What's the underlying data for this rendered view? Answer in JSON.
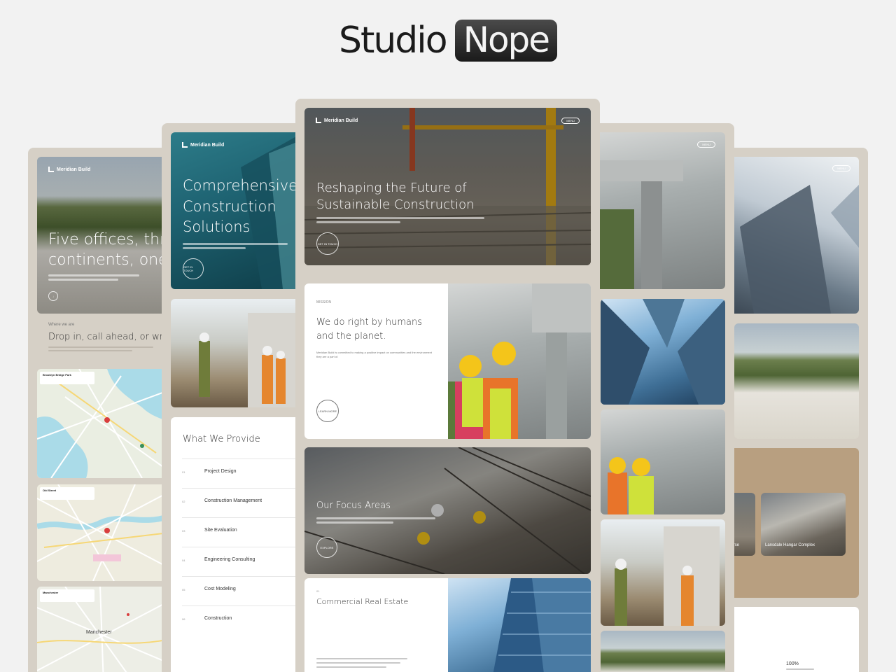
{
  "logo": {
    "word1": "Studio",
    "word2": "Nope"
  },
  "brand": "Meridian Build",
  "menu_label": "MENU",
  "hero_center": {
    "title_line1": "Reshaping the Future of",
    "title_line2": "Sustainable Construction",
    "cta": "GET IN TOUCH"
  },
  "hero_left2": {
    "title_line1": "Comprehensive",
    "title_line2": "Construction",
    "title_line3": "Solutions",
    "cta": "GET IN TOUCH"
  },
  "hero_left1": {
    "title_line1": "Five offices, thre",
    "title_line2": "continents, one"
  },
  "visit": {
    "eyebrow": "Where we are",
    "heading": "Drop in, call ahead, or write"
  },
  "maps": [
    {
      "title": "Brooklyn Bridge Park"
    },
    {
      "title": "Old Street"
    },
    {
      "title": "Manchester",
      "city_label": "Manchester"
    }
  ],
  "mission": {
    "eyebrow": "MISSION",
    "heading_line1": "We do right by humans",
    "heading_line2": "and the planet.",
    "body": "Meridian Build is committed to making a positive impact on communities and the environment they are a part of.",
    "cta": "LEARN MORE"
  },
  "focus": {
    "heading": "Our Focus Areas",
    "cta": "EXPLORE"
  },
  "commercial": {
    "eyebrow": "01",
    "heading": "Commercial Real Estate"
  },
  "provide": {
    "heading": "What We Provide",
    "items": [
      {
        "num": "01",
        "label": "Project Design"
      },
      {
        "num": "02",
        "label": "Construction Management"
      },
      {
        "num": "03",
        "label": "Site Evaluation"
      },
      {
        "num": "04",
        "label": "Engineering Consulting"
      },
      {
        "num": "05",
        "label": "Cost Modeling"
      },
      {
        "num": "06",
        "label": "Construction"
      }
    ]
  },
  "projects": [
    {
      "label": "ourse"
    },
    {
      "label": "Lansdale Hangar Complex"
    }
  ],
  "stat": {
    "value": "100%"
  },
  "colors": {
    "frame": "#d6d0c6",
    "tan_panel": "#b89f80",
    "page_bg": "#f2f2f2"
  }
}
